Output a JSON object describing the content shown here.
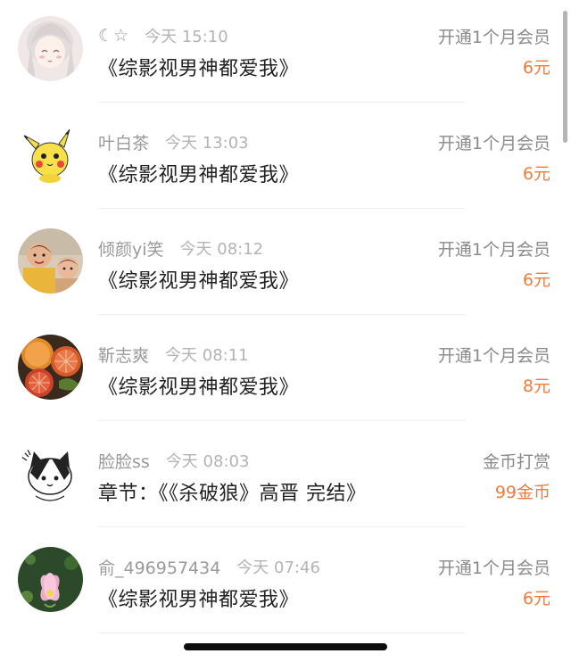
{
  "rows": [
    {
      "username": "☾☆",
      "time": "今天 15:10",
      "content": "《综影视男神都爱我》",
      "action": "开通1个月会员",
      "amount": "6元",
      "avatar_icon": "anime-girl-avatar"
    },
    {
      "username": "叶白茶",
      "time": "今天 13:03",
      "content": "《综影视男神都爱我》",
      "action": "开通1个月会员",
      "amount": "6元",
      "avatar_icon": "pikachu-avatar"
    },
    {
      "username": "倾颜yi笑",
      "time": "今天 08:12",
      "content": "《综影视男神都爱我》",
      "action": "开通1个月会员",
      "amount": "6元",
      "avatar_icon": "children-photo-avatar"
    },
    {
      "username": "靳志爽",
      "time": "今天 08:11",
      "content": "《综影视男神都爱我》",
      "action": "开通1个月会员",
      "amount": "8元",
      "avatar_icon": "grapefruit-avatar"
    },
    {
      "username": "脸脸ss",
      "time": "今天 08:03",
      "content": "章节：《《杀破狼》高晋 完结》",
      "action": "金币打赏",
      "amount": "99金币",
      "avatar_icon": "cartoon-cat-avatar"
    },
    {
      "username": "俞_496957434",
      "time": "今天 07:46",
      "content": "《综影视男神都爱我》",
      "action": "开通1个月会员",
      "amount": "6元",
      "avatar_icon": "lotus-flower-avatar"
    }
  ],
  "colors": {
    "amount": "#f07c3c",
    "username": "#9a9a9a",
    "content": "#222222"
  }
}
